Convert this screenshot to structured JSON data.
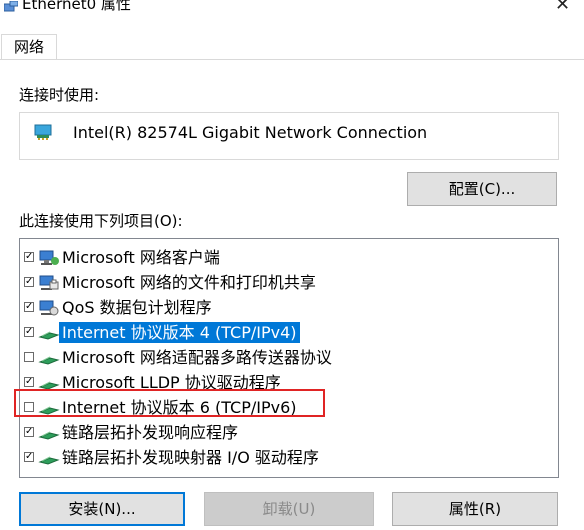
{
  "window": {
    "title": "Ethernet0 属性",
    "close_glyph": "✕"
  },
  "tabs": [
    {
      "label": "网络"
    }
  ],
  "connect_using": {
    "label": "连接时使用:",
    "adapter": {
      "name": "Intel(R) 82574L Gigabit Network Connection",
      "icon": "network-adapter-icon"
    },
    "configure_button": "配置(C)..."
  },
  "items_section": {
    "label": "此连接使用下列项目(O):",
    "items": [
      {
        "label": "Microsoft 网络客户端",
        "checked": true,
        "selected": false,
        "icon": "network-client-icon"
      },
      {
        "label": "Microsoft 网络的文件和打印机共享",
        "checked": true,
        "selected": false,
        "icon": "file-printer-share-icon"
      },
      {
        "label": "QoS 数据包计划程序",
        "checked": true,
        "selected": false,
        "icon": "qos-scheduler-icon"
      },
      {
        "label": "Internet 协议版本 4 (TCP/IPv4)",
        "checked": true,
        "selected": true,
        "icon": "protocol-icon"
      },
      {
        "label": "Microsoft 网络适配器多路传送器协议",
        "checked": false,
        "selected": false,
        "icon": "protocol-icon"
      },
      {
        "label": "Microsoft LLDP 协议驱动程序",
        "checked": true,
        "selected": false,
        "icon": "protocol-icon"
      },
      {
        "label": "Internet 协议版本 6 (TCP/IPv6)",
        "checked": false,
        "selected": false,
        "icon": "protocol-icon"
      },
      {
        "label": "链路层拓扑发现响应程序",
        "checked": true,
        "selected": false,
        "icon": "protocol-icon"
      },
      {
        "label": "链路层拓扑发现映射器 I/O 驱动程序",
        "checked": true,
        "selected": false,
        "icon": "protocol-icon"
      }
    ]
  },
  "buttons": {
    "install": "安装(N)...",
    "uninstall": "卸载(U)",
    "properties": "属性(R)"
  },
  "colors": {
    "selection": "#0078d7",
    "highlight_box": "#e02424"
  }
}
